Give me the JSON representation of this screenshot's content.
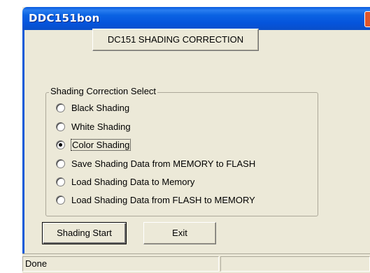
{
  "window": {
    "title": "DDC151bon"
  },
  "heading_button": "DC151 SHADING CORRECTION",
  "group": {
    "legend": "Shading Correction Select",
    "options": [
      {
        "label": "Black Shading",
        "checked": false
      },
      {
        "label": "White Shading",
        "checked": false
      },
      {
        "label": "Color Shading",
        "checked": true
      },
      {
        "label": "Save Shading Data from MEMORY to FLASH",
        "checked": false
      },
      {
        "label": "Load Shading Data to Memory",
        "checked": false
      },
      {
        "label": "Load Shading Data from FLASH to MEMORY",
        "checked": false
      }
    ]
  },
  "buttons": {
    "start": "Shading Start",
    "exit": "Exit"
  },
  "status": {
    "text": "Done",
    "pane2": ""
  }
}
